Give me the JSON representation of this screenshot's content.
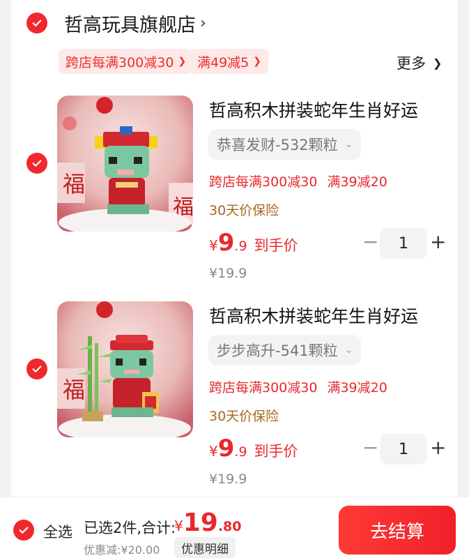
{
  "store": {
    "name": "哲高玩具旗舰店",
    "promos": [
      "跨店每满300减30",
      "满49减5"
    ],
    "more_label": "更多"
  },
  "items": [
    {
      "title": "哲高积木拼装蛇年生肖好运",
      "sku": "恭喜发财-532颗粒",
      "promos": [
        "跨店每满300减30",
        "满39减20"
      ],
      "guarantee": "30天价保险",
      "price_symbol": "¥",
      "price_int": "9",
      "price_dec": ".9",
      "price_suffix": "到手价",
      "orig_price": "¥19.9",
      "qty": "1",
      "image": "snake-fortune-red"
    },
    {
      "title": "哲高积木拼装蛇年生肖好运",
      "sku": "步步高升-541颗粒",
      "promos": [
        "跨店每满300减30",
        "满39减20"
      ],
      "guarantee": "30天价保险",
      "price_symbol": "¥",
      "price_int": "9",
      "price_dec": ".9",
      "price_suffix": "到手价",
      "orig_price": "¥19.9",
      "qty": "1",
      "image": "snake-bamboo-red"
    }
  ],
  "footer": {
    "select_all_label": "全选",
    "selected_text": "已选2件,合计:",
    "total_symbol": "¥",
    "total_int": "19",
    "total_dec": ".80",
    "discount_text": "优惠减:¥20.00",
    "detail_label": "优惠明细",
    "checkout_label": "去结算"
  },
  "colors": {
    "accent": "#f0282d",
    "price": "#e8282d",
    "promo_bg": "#fde9e7",
    "guarantee": "#a8671f"
  }
}
